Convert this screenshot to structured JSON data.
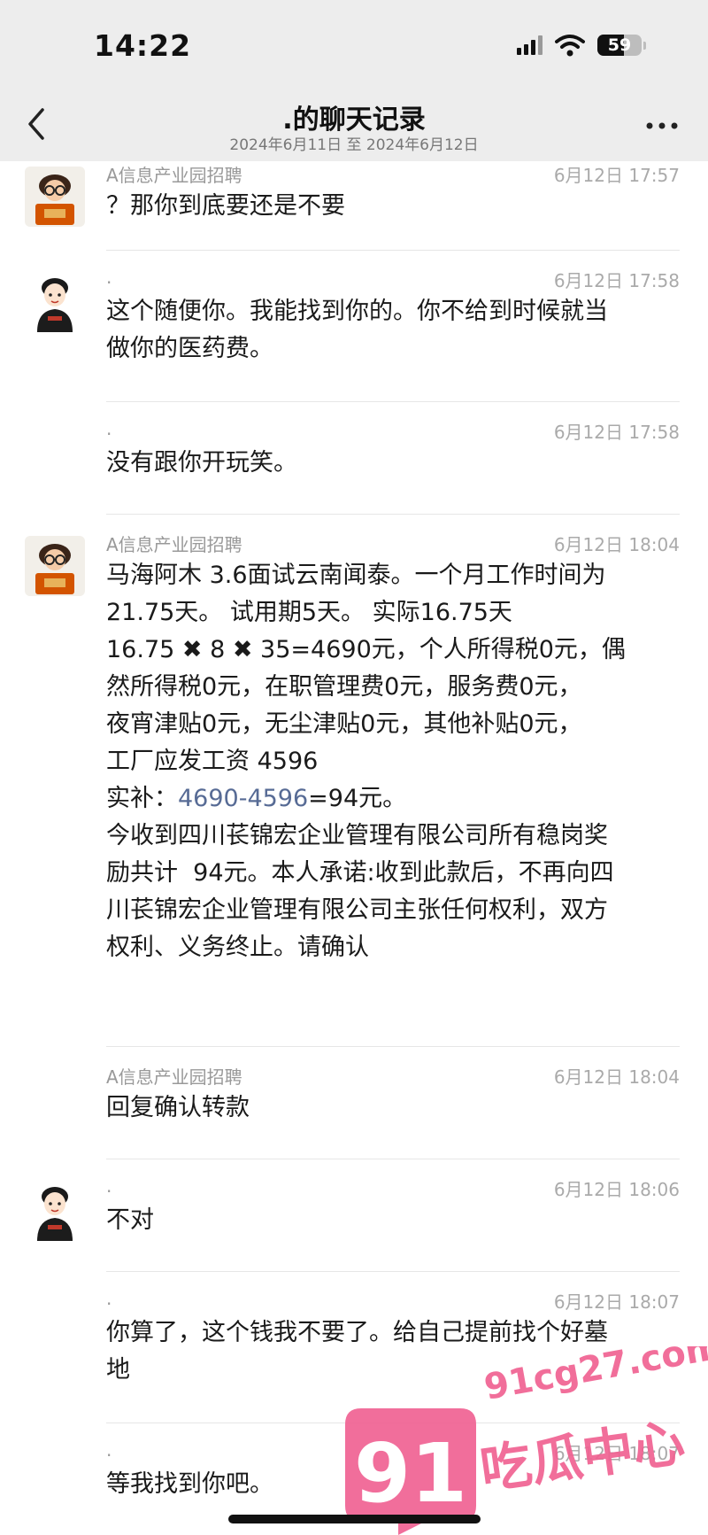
{
  "status_bar": {
    "time": "14:22",
    "battery": "59",
    "battery_level": 0.59,
    "icons": [
      "signal-icon",
      "wifi-icon",
      "battery-icon"
    ]
  },
  "header": {
    "title": ".的聊天记录",
    "subtitle": "2024年6月11日 至 2024年6月12日",
    "back_icon": "chevron-left-icon",
    "more_icon": "ellipsis-icon"
  },
  "messages": [
    {
      "sender": "A信息产业园招聘",
      "time": "6月12日 17:57",
      "avatar": "recruiter",
      "lines": [
        "？那你到底要还是不要"
      ]
    },
    {
      "sender": ".",
      "time": "6月12日 17:58",
      "avatar": "user",
      "lines": [
        "这个随便你。我能找到你的。你不给到时候就当",
        "做你的医药费。"
      ]
    },
    {
      "sender": ".",
      "time": "6月12日 17:58",
      "avatar": "",
      "lines": [
        "没有跟你开玩笑。"
      ]
    },
    {
      "sender": "A信息产业园招聘",
      "time": "6月12日 18:04",
      "avatar": "recruiter",
      "lines": [
        "马海阿木 3.6面试云南闻泰。一个月工作时间为",
        "21.75天。 试用期5天。 实际16.75天",
        "",
        "16.75 ✖ 8 ✖ 35=4690元，个人所得税0元，偶",
        "然所得税0元，在职管理费0元，服务费0元，",
        "夜宵津贴0元，无尘津贴0元，其他补贴0元，",
        "工厂应发工资 4596"
      ],
      "calc_prefix": "实补：",
      "calc_link": "4690-4596",
      "calc_suffix": "=94元。",
      "tail_lines": [
        "今收到四川苌锦宏企业管理有限公司所有稳岗奖",
        "励共计  94元。本人承诺:收到此款后，不再向四",
        "川苌锦宏企业管理有限公司主张任何权利，双方",
        "权利、义务终止。请确认"
      ]
    },
    {
      "sender": "A信息产业园招聘",
      "time": "6月12日 18:04",
      "avatar": "",
      "lines": [
        "回复确认转款"
      ]
    },
    {
      "sender": ".",
      "time": "6月12日 18:06",
      "avatar": "user",
      "lines": [
        "不对"
      ]
    },
    {
      "sender": ".",
      "time": "6月12日 18:07",
      "avatar": "",
      "lines": [
        "你算了，这个钱我不要了。给自己提前找个好墓",
        "地"
      ]
    },
    {
      "sender": ".",
      "time": "6月12日 18:07",
      "avatar": "",
      "lines": [
        "等我找到你吧。"
      ]
    }
  ],
  "watermark": {
    "number": "91",
    "site": "91cg27.com",
    "brand": "吃瓜中心"
  }
}
